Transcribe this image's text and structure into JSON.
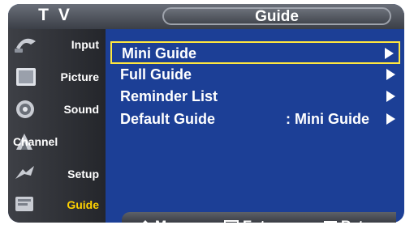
{
  "header": {
    "category": "T V",
    "title": "Guide"
  },
  "sidebar": {
    "items": [
      {
        "label": "Input",
        "icon": "input-icon",
        "active": false
      },
      {
        "label": "Picture",
        "icon": "picture-icon",
        "active": false
      },
      {
        "label": "Sound",
        "icon": "sound-icon",
        "active": false
      },
      {
        "label": "Channel",
        "icon": "channel-icon",
        "active": false
      },
      {
        "label": "Setup",
        "icon": "setup-icon",
        "active": false
      },
      {
        "label": "Guide",
        "icon": "guide-icon",
        "active": true
      }
    ]
  },
  "menu": {
    "items": [
      {
        "label": "Mini Guide",
        "value": "",
        "selected": true
      },
      {
        "label": "Full Guide",
        "value": "",
        "selected": false
      },
      {
        "label": "Reminder List",
        "value": "",
        "selected": false
      },
      {
        "label": "Default Guide",
        "value": ": Mini Guide",
        "selected": false
      }
    ]
  },
  "footer": {
    "move": "Move",
    "enter": "Enter",
    "return": "Return"
  },
  "colors": {
    "background": "#1c3f96",
    "sidebar": "#2f3136",
    "highlight": "#ffe73f",
    "active_label": "#ffd200",
    "text": "#ffffff"
  }
}
